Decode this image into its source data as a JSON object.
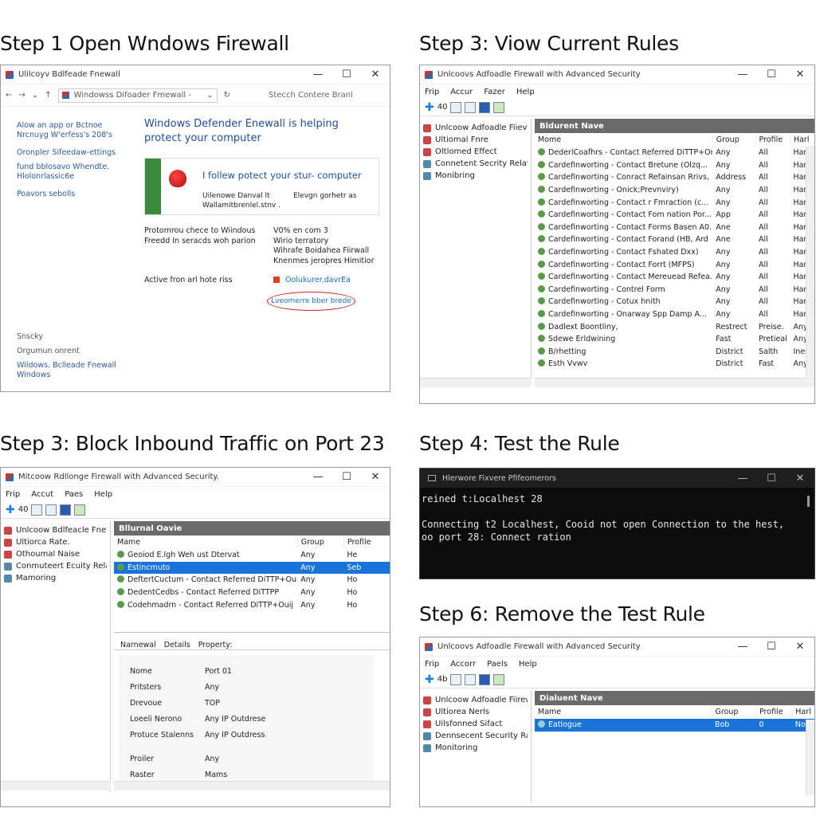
{
  "steps": {
    "s1": "Step 1 Open Wndows Firewall",
    "s2": "Step 3: Viow Current Rules",
    "s3": "Step 3: Block Inbound Traffic on Port 23",
    "s4": "Step 4: Test the Rule",
    "s6": "Step 6: Remove the Test Rule"
  },
  "w1": {
    "title": "Ulilcoyv Bdlfeade Fnewall",
    "address": "Windowss Difoader Fmewall -",
    "search": "Stecch Contere Branl",
    "side_links": [
      "Alow an app or Bctnoe",
      "Nrcnuyg W'erfess's 208's",
      "Oronpler Sifeedaw-ettings",
      "fund bblosavo Whendte.",
      "Hlolonrlassic6e",
      "Poavors sebolls"
    ],
    "side_bottom": [
      "Snscky",
      "Orgumun onrent",
      "Wildows. Bclleade Fnewall",
      "Windows"
    ],
    "heading": "Windows Defender Enewall is helping protect your computer",
    "banner_title": "I follew potect your stur- computer",
    "banner_left": "Uilenowe Danval lt",
    "banner_left2": "Wallamitbrenlel.stnv .",
    "banner_right": "Elevgn gorhetr as",
    "info": [
      {
        "k": "Protomrou chece to Wiindous",
        "v": "V0% en com 3"
      },
      {
        "k": "Freedd In seracds woh parion",
        "v": "Wirio terratory"
      },
      {
        "k": "",
        "v": "Wihrafe Boidahea Fiirwall"
      },
      {
        "k": "",
        "v": "Knenmes jeropres Himitior"
      }
    ],
    "active_label": "Active fron arl hote riss",
    "active_value": "Oolukurer.davrEa",
    "circled_link": "Lveomerre bber brede"
  },
  "w2": {
    "title": "Unlcoovs Adfoadle Firewall with Advanced Security",
    "menu": [
      "Frip",
      "Accur",
      "Fazer",
      "Help"
    ],
    "toolbar_num": "40",
    "tree": [
      "Unlcoow Adfoadle Fiievall",
      "Ultiomal Fnre",
      "Oltlomed Effect",
      "Connetent Secrity Relav.",
      "Monibring"
    ],
    "pane_title": "Bldurent Nave",
    "columns": [
      "Mome",
      "Group",
      "Profile",
      "Harl"
    ],
    "rows": [
      [
        "DederlCoafhrs - Contact Referred DiTTP+Omi)",
        "Any",
        "All",
        "Harl"
      ],
      [
        "Cardefinworting - Contact Bretune (Olzq...",
        "Any",
        "All",
        "Harl"
      ],
      [
        "Cardefinworting - Conract Refainsan Rrivs,",
        "Address",
        "All",
        "Harl"
      ],
      [
        "Cardefinworting - Onick;Prevnviry)",
        "Any",
        "All",
        "Harl"
      ],
      [
        "Cardefinworting - Contact r Fmraction (c...",
        "Any",
        "All",
        "Harl"
      ],
      [
        "Cardefinworting - Contact Fom nation Por...",
        "App",
        "All",
        "Harl"
      ],
      [
        "Cardefinworting - Contact Forms Basen A0...",
        "Ane",
        "All",
        "Harl"
      ],
      [
        "Cardefinworting - Contact Forand (HB, Ard",
        "Ane",
        "All",
        "Harl"
      ],
      [
        "Cardefinworting - Contact Fshated Dxx)",
        "Any",
        "All",
        "Harl"
      ],
      [
        "Cardefinworting - Contact Forrt (MFPS)",
        "Any",
        "All",
        "Harl"
      ],
      [
        "Cardefinworting - Contact Mereuead Refea...",
        "Any",
        "All",
        "Harl"
      ],
      [
        "Cardefinworting - Contrel Form",
        "Any",
        "All",
        "Harl"
      ],
      [
        "Cardefinworting - Cotux hnith",
        "Any",
        "All",
        "Harl"
      ],
      [
        "Cardefinworting - Onarway Spp Damp A...",
        "Any",
        "All",
        "Harl"
      ],
      [
        "Dadlext Boontliny,",
        "Restrect",
        "Preise.",
        "Any"
      ],
      [
        "Sdewe Erldwining",
        "Fast",
        "Pretieal",
        "Any"
      ],
      [
        "B/rhetting",
        "District",
        "Salth",
        "Ined"
      ],
      [
        "Esth Vvwv",
        "District",
        "Fast",
        "Any"
      ]
    ]
  },
  "w3": {
    "title": "Mitcoow Rdllonge Firewall with Advanced Security.",
    "menu": [
      "Frip",
      "Accut",
      "Paes",
      "Help"
    ],
    "toolbar_num": "40",
    "tree": [
      "Unlcoow Bdlfeacle Fnewl|",
      "Ultiorca Rate.",
      "Othoumal Naise",
      "Conmuteert Ecuity Relav",
      "Mamoring"
    ],
    "pane_title": "Bllurnal Oavie",
    "columns": [
      "Mame",
      "Group",
      "Profile"
    ],
    "rows": [
      [
        "Geoiod E.lgh Weh ust Dtervat",
        "Any",
        "He"
      ],
      [
        "Estincmuto",
        "Any",
        "Seb"
      ],
      [
        "DeftertCuctum - Contact Referred DiTTP+Ouij",
        "Any",
        "Ho"
      ],
      [
        "DedentCedbs - Contact Referred DiTTPP",
        "Any",
        "Ho"
      ],
      [
        "Codehmadrn - Contact Referred DiTTP+Ouij",
        "Any",
        "Ho"
      ]
    ],
    "prop_tabs": [
      "Narnewal",
      "Details",
      "Property:"
    ],
    "props": [
      [
        "Nome",
        "Port 01"
      ],
      [
        "Pritsters",
        "Any"
      ],
      [
        "Drevoue",
        "TOP"
      ],
      [
        "Loeeli Nerono",
        "Any IP Outdrese"
      ],
      [
        "Protuce Stalenns",
        "Any IP Outdress"
      ],
      [
        "Proiler",
        "Any"
      ],
      [
        "Raster",
        "Mams"
      ]
    ]
  },
  "w4": {
    "title": "Hlerwore Fixvere Pfifeomerors",
    "cmd": "reined t:Localhest 28",
    "out1": "Connecting t2 Localhest, Cooid not open Connection to the hest,",
    "out2": "oo port 28: Connect ration"
  },
  "w6": {
    "title": "Unlcoovs Adfoadle Firewall with Advanced Security",
    "menu": [
      "Frip",
      "Accorr",
      "Paels",
      "Help"
    ],
    "toolbar_num": "4b",
    "tree": [
      "Unlcoow Adfoadle Fiirewall",
      "Ultiorea Nerls",
      "Uilsfonned Sifact",
      "Dennsecent Security Rater",
      "Monitoring"
    ],
    "pane_title": "Dialuent Nave",
    "columns": [
      "Mame",
      "Group",
      "Profile",
      "Harl"
    ],
    "row": [
      "Eatlogue",
      "Bob",
      "0",
      "Non"
    ]
  },
  "colors": {
    "selection": "#1a73d9",
    "link": "#1a6fc0",
    "shield_green": "#3a8a3a",
    "circle_red": "#d02020"
  }
}
